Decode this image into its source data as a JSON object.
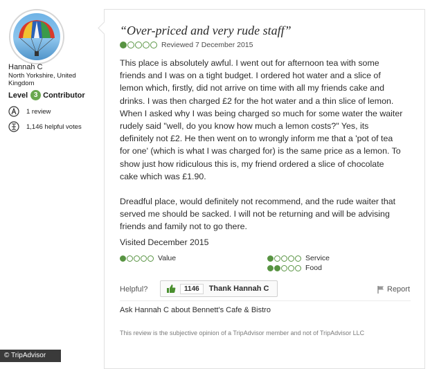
{
  "member": {
    "name": "Hannah C",
    "location": "North Yorkshire, United Kingdom",
    "level_label": "Level",
    "level_number": "3",
    "level_title": "Contributor",
    "reviews": "1 review",
    "helpful_votes": "1,146 helpful votes"
  },
  "review": {
    "title": "“Over-priced and very rude staff”",
    "rating": 1,
    "rating_max": 5,
    "reviewed_date": "Reviewed 7 December 2015",
    "paragraphs": [
      "This place is absolutely awful. I went out for afternoon tea with some friends and I was on a tight budget. I ordered hot water and a slice of lemon which, firstly, did not arrive on time with all my friends cake and drinks. I was then charged £2 for the hot water and a thin slice of lemon. When I asked why I was being charged so much for some water the waiter rudely said \"well, do you know how much a lemon costs?\" Yes, its definitely not £2. He then went on to wrongly inform me that a 'pot of tea for one' (which is what I was charged for) is the same price as a lemon. To show just how ridiculous this is, my friend ordered a slice of chocolate cake which was £1.90.",
      "Dreadful place, would definitely not recommend, and the rude waiter that served me should be sacked. I will not be returning and will be advising friends and family not to go there."
    ],
    "visited": "Visited December 2015",
    "sub_ratings": [
      {
        "label": "Value",
        "score": 1
      },
      {
        "label": "Service",
        "score": 1
      },
      {
        "label": "Food",
        "score": 2
      }
    ],
    "helpful_label": "Helpful?",
    "thank_count": "1146",
    "thank_label": "Thank Hannah C",
    "report_label": "Report",
    "ask_text": "Ask Hannah C about Bennett's Cafe & Bistro",
    "disclaimer": "This review is the subjective opinion of a TripAdvisor member and not of TripAdvisor LLC"
  },
  "watermark": "© TripAdvisor",
  "colors": {
    "bubble_green": "#589442",
    "level_badge": "#6aa84f",
    "thumb_green": "#4a8f2f"
  },
  "icons": {
    "avatar": "avatar-parachute-photo",
    "reviews": "reviews-badge-icon",
    "votes": "helpful-votes-icon",
    "thumb": "thumbs-up-icon",
    "report": "flag-icon"
  }
}
